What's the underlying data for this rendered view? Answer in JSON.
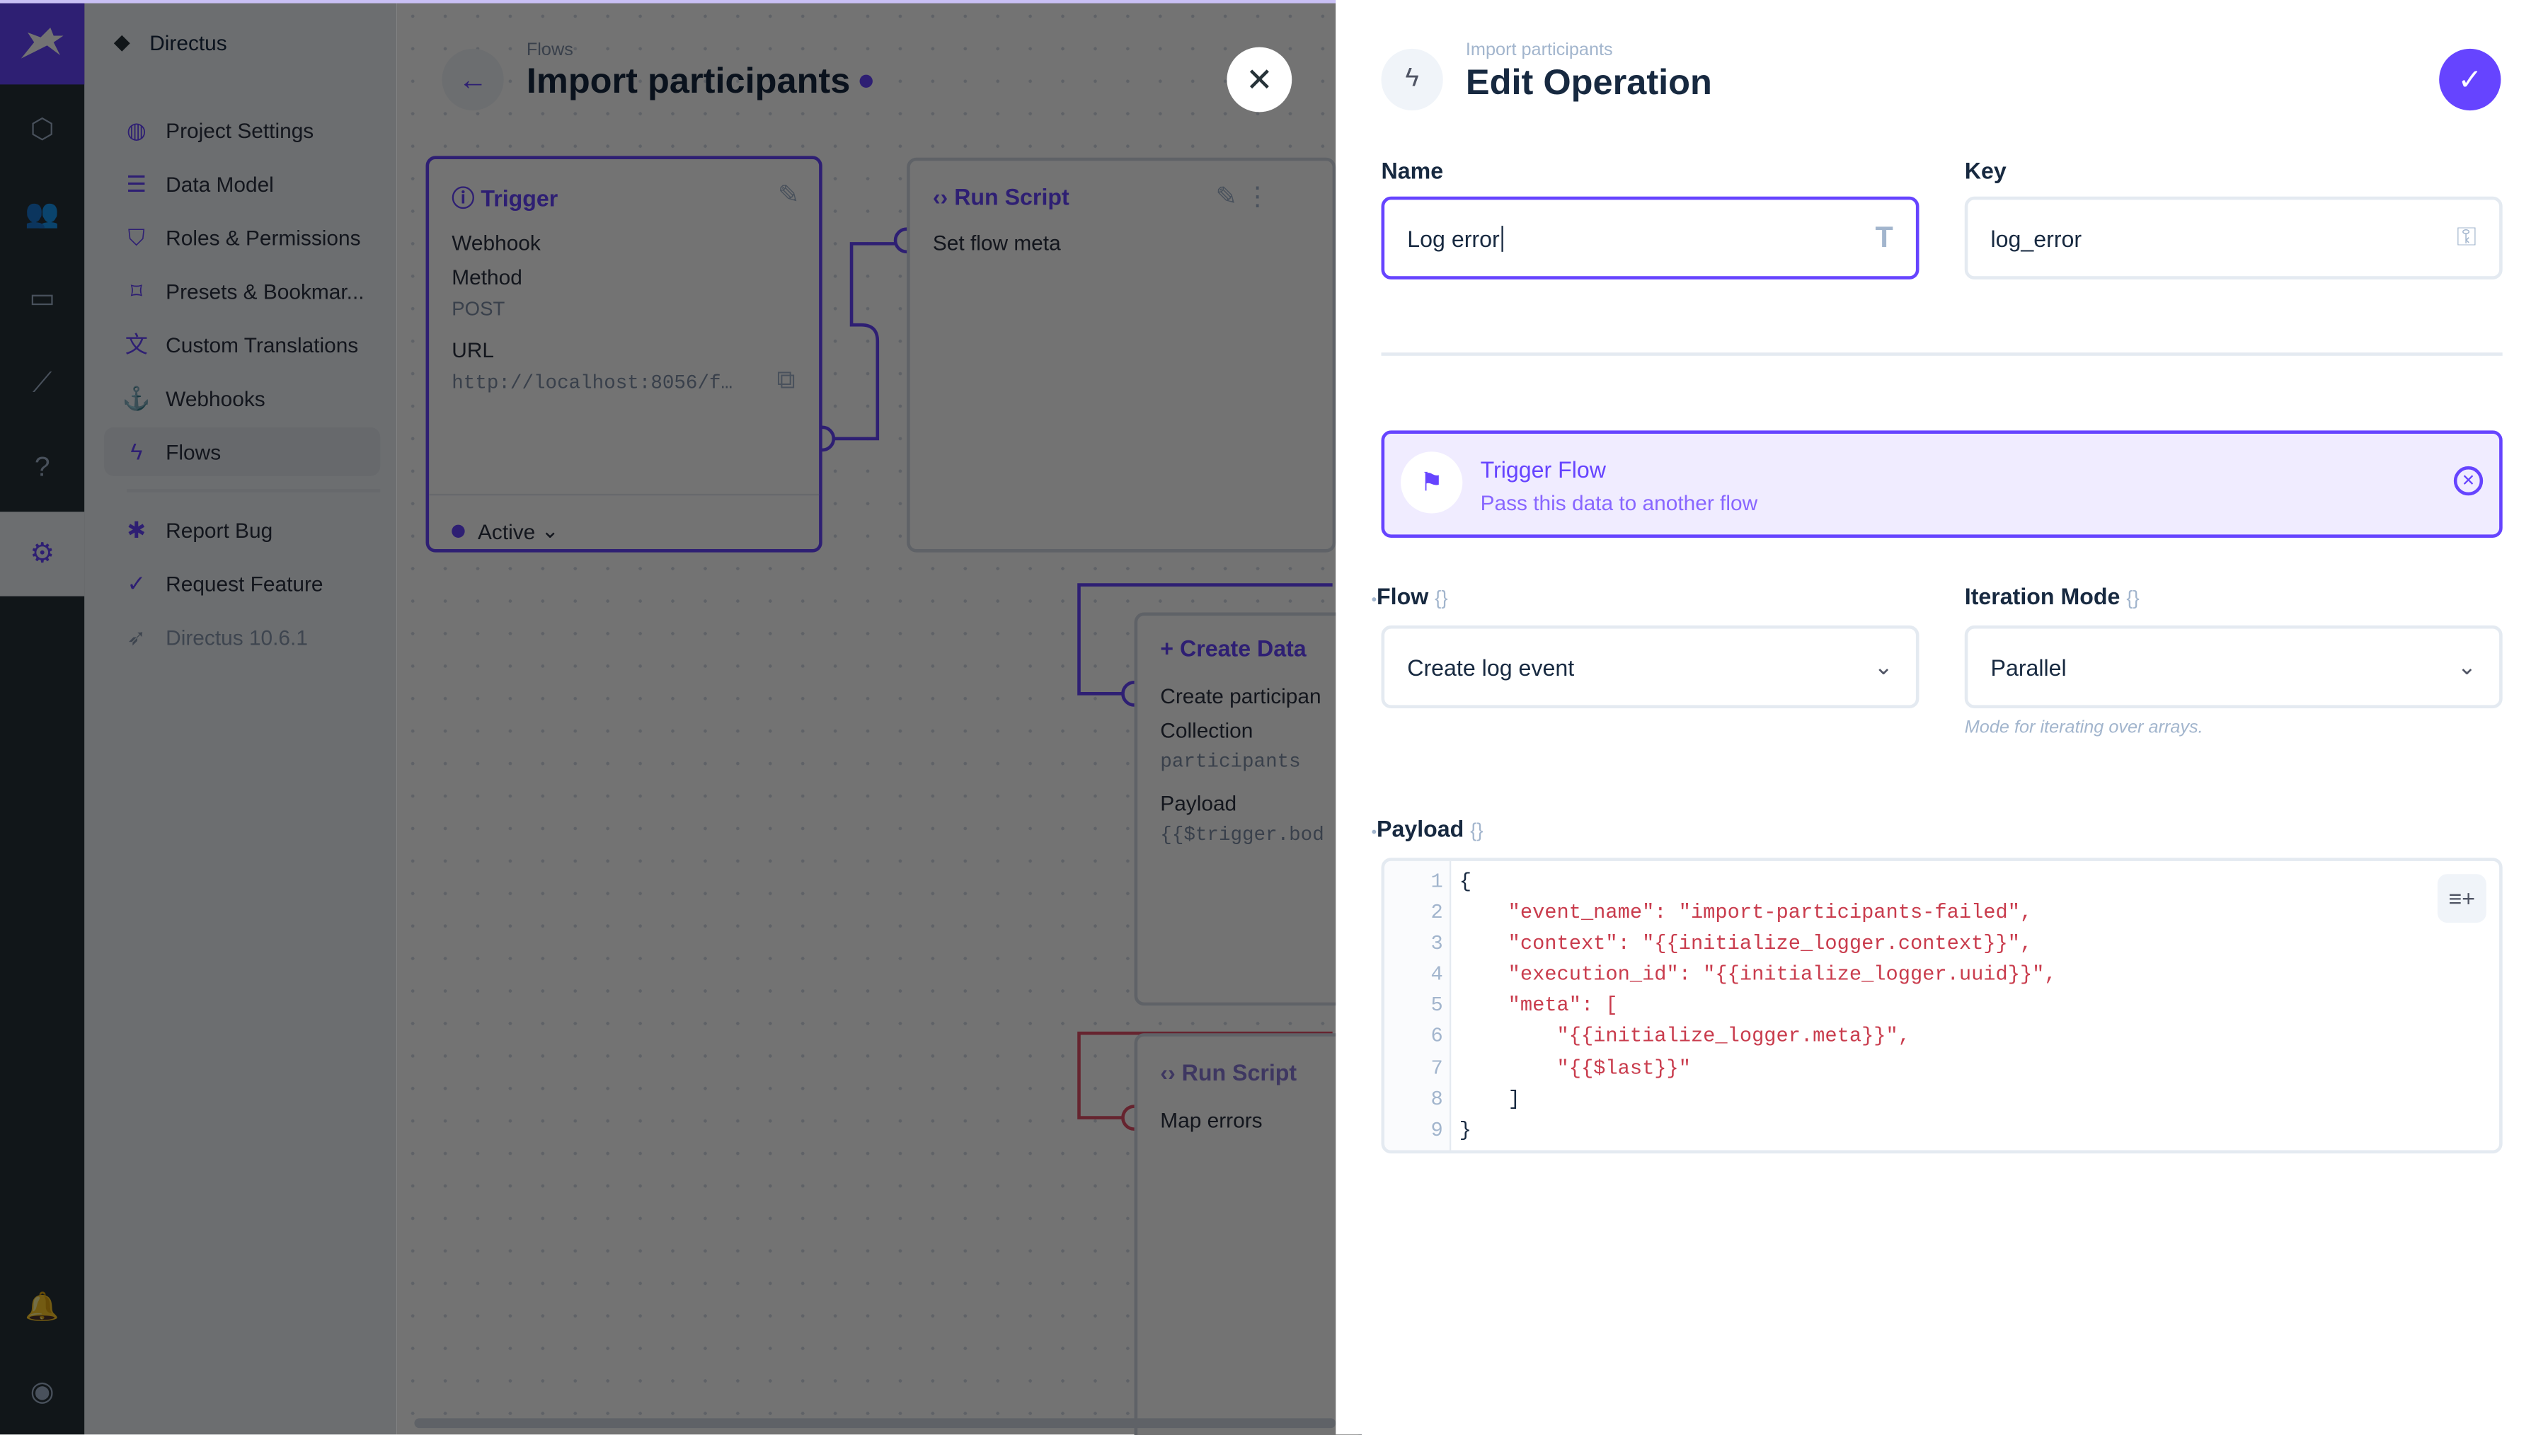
{
  "nav": {
    "project": "Directus",
    "items": [
      {
        "label": "Project Settings",
        "icon": "globe-icon"
      },
      {
        "label": "Data Model",
        "icon": "list-icon"
      },
      {
        "label": "Roles & Permissions",
        "icon": "shield-icon"
      },
      {
        "label": "Presets & Bookmar...",
        "icon": "bookmark-icon"
      },
      {
        "label": "Custom Translations",
        "icon": "translate-icon"
      },
      {
        "label": "Webhooks",
        "icon": "anchor-icon"
      },
      {
        "label": "Flows",
        "icon": "bolt-icon"
      },
      {
        "label": "Report Bug",
        "icon": "bug-icon"
      },
      {
        "label": "Request Feature",
        "icon": "verified-icon"
      }
    ],
    "version": "Directus 10.6.1"
  },
  "flow_header": {
    "breadcrumb": "Flows",
    "title": "Import participants"
  },
  "canvas": {
    "trigger": {
      "title": "Trigger",
      "type": "Webhook",
      "method_label": "Method",
      "method": "POST",
      "url_label": "URL",
      "url": "http://localhost:8056/f…",
      "status": "Active"
    },
    "run_script": {
      "title": "Run Script",
      "subtitle": "Set flow meta"
    },
    "create_data": {
      "title": "Create Data",
      "subtitle": "Create participan",
      "collection_label": "Collection",
      "collection": "participants",
      "payload_label": "Payload",
      "payload": "{{$trigger.bod"
    },
    "run_script_2": {
      "title": "Run Script",
      "subtitle": "Map errors"
    }
  },
  "panel": {
    "breadcrumb": "Import participants",
    "title": "Edit Operation",
    "name_label": "Name",
    "name_value": "Log error",
    "key_label": "Key",
    "key_value": "log_error",
    "operation": {
      "title": "Trigger Flow",
      "description": "Pass this data to another flow"
    },
    "flow_label": "Flow",
    "flow_value": "Create log event",
    "iteration_label": "Iteration Mode",
    "iteration_value": "Parallel",
    "iteration_hint": "Mode for iterating over arrays.",
    "payload_label": "Payload",
    "payload_lines": [
      "{",
      "    \"event_name\": \"import-participants-failed\",",
      "    \"context\": \"{{initialize_logger.context}}\",",
      "    \"execution_id\": \"{{initialize_logger.uuid}}\",",
      "    \"meta\": [",
      "        \"{{initialize_logger.meta}}\",",
      "        \"{{$last}}\"",
      "    ]",
      "}"
    ],
    "line_numbers": [
      "1",
      "2",
      "3",
      "4",
      "5",
      "6",
      "7",
      "8",
      "9"
    ]
  },
  "colors": {
    "accent": "#6644ff",
    "rail": "#263238",
    "string": "#c93c4d"
  }
}
